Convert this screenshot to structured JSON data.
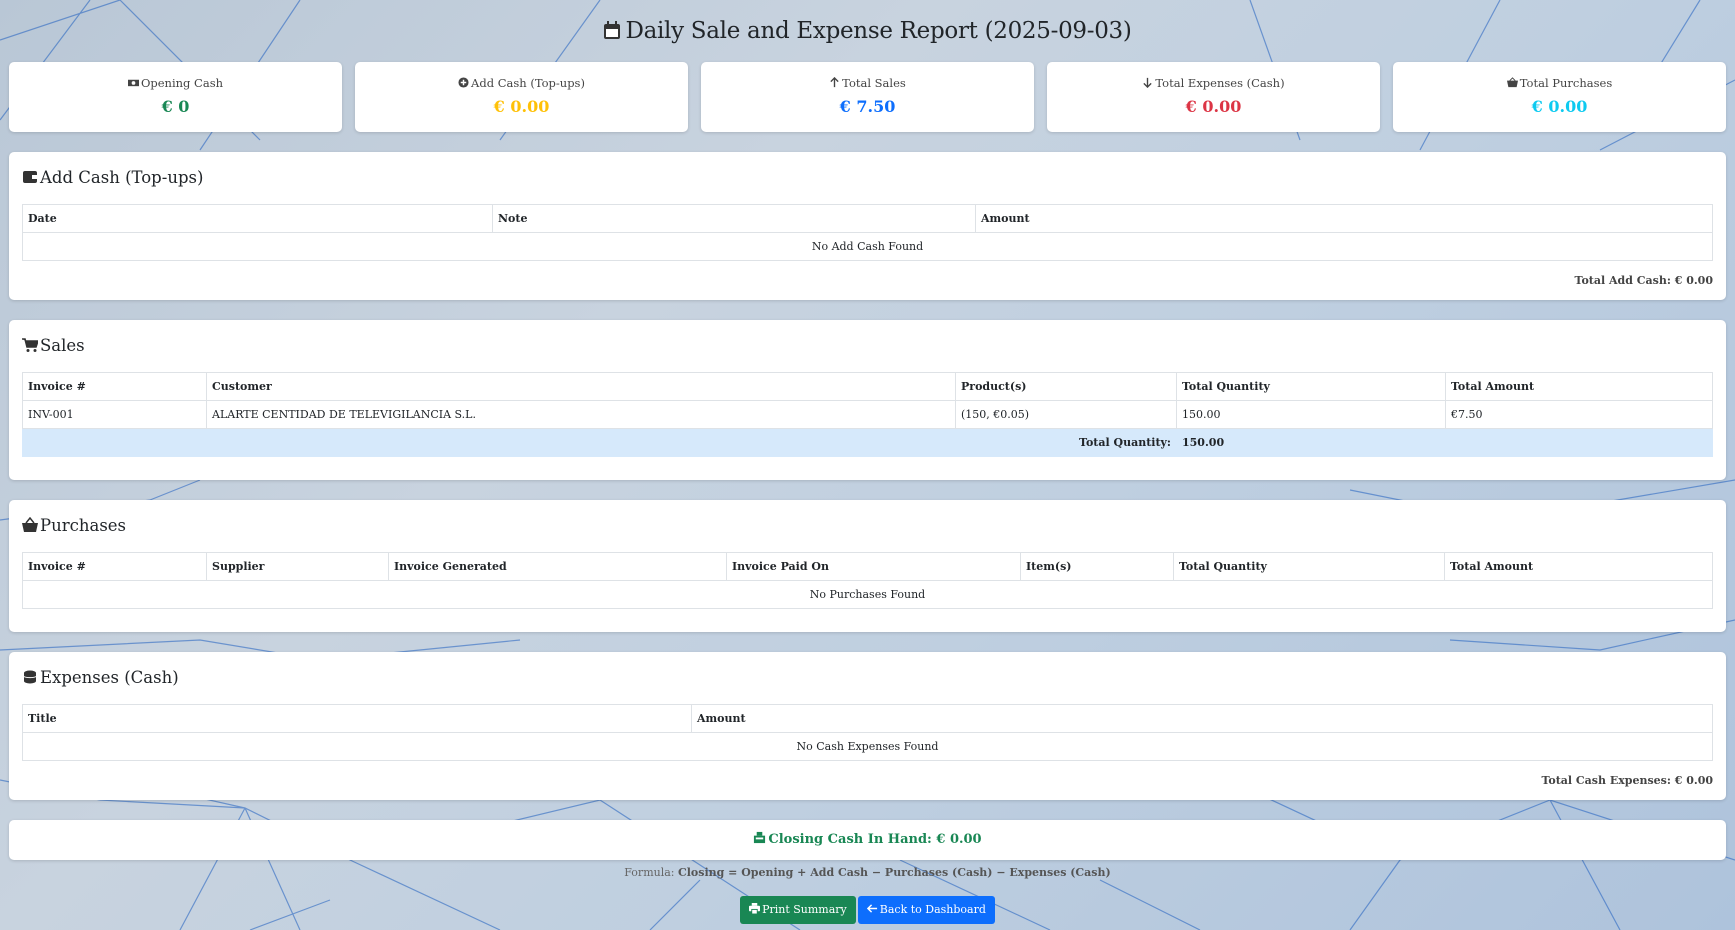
{
  "page": {
    "title": "Daily Sale and Expense Report (2025-09-03)",
    "icon": "calendar-icon"
  },
  "stats": [
    {
      "label": "Opening Cash",
      "value": "€ 0",
      "icon": "money-icon",
      "color": "#198754"
    },
    {
      "label": "Add Cash (Top-ups)",
      "value": "€ 0.00",
      "icon": "plus-circle-icon",
      "color": "#ffc107"
    },
    {
      "label": "Total Sales",
      "value": "€ 7.50",
      "icon": "arrow-up-icon",
      "color": "#0d6efd"
    },
    {
      "label": "Total Expenses (Cash)",
      "value": "€ 0.00",
      "icon": "arrow-down-icon",
      "color": "#dc3545"
    },
    {
      "label": "Total Purchases",
      "value": "€ 0.00",
      "icon": "basket-icon",
      "color": "#0dcaf0"
    }
  ],
  "add_cash": {
    "heading": "Add Cash (Top-ups)",
    "columns": [
      "Date",
      "Note",
      "Amount"
    ],
    "empty": "No Add Cash Found",
    "total": "Total Add Cash: € 0.00"
  },
  "sales": {
    "heading": "Sales",
    "columns": [
      "Invoice #",
      "Customer",
      "Product(s)",
      "Total Quantity",
      "Total Amount"
    ],
    "rows": [
      {
        "invoice": "INV-001",
        "customer": "ALARTE CENTIDAD DE TELEVIGILANCIA S.L.",
        "products": "(150, €0.05)",
        "quantity": "150.00",
        "amount": "€7.50"
      }
    ],
    "total_label": "Total Quantity:",
    "total_value": "150.00"
  },
  "purchases": {
    "heading": "Purchases",
    "columns": [
      "Invoice #",
      "Supplier",
      "Invoice Generated",
      "Invoice Paid On",
      "Item(s)",
      "Total Quantity",
      "Total Amount"
    ],
    "empty": "No Purchases Found"
  },
  "expenses": {
    "heading": "Expenses (Cash)",
    "columns": [
      "Title",
      "Amount"
    ],
    "empty": "No Cash Expenses Found",
    "total": "Total Cash Expenses: € 0.00"
  },
  "closing": {
    "text": "Closing Cash In Hand: € 0.00",
    "formula_prefix": "Formula:",
    "formula": "Closing = Opening + Add Cash − Purchases (Cash) − Expenses (Cash)"
  },
  "buttons": {
    "print": "Print Summary",
    "back": "Back to Dashboard"
  }
}
